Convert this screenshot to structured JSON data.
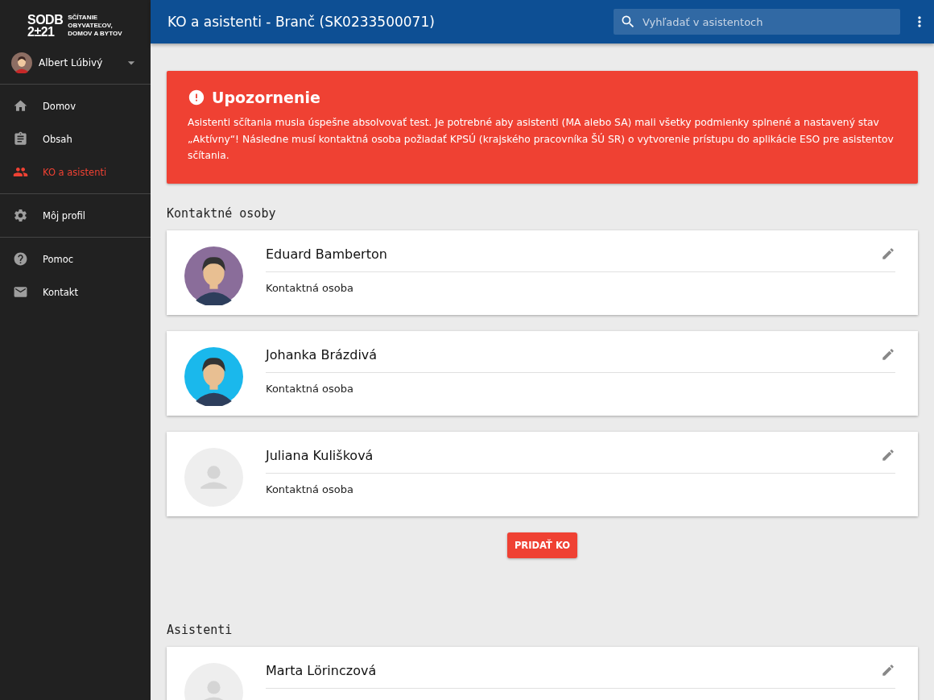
{
  "logo": {
    "mark_top": "SODB",
    "mark_bottom": "2±21",
    "text": "SČÍTANIE OBYVATEĽOV, DOMOV A BYTOV"
  },
  "user": {
    "name": "Albert Lúbivý"
  },
  "nav": [
    [
      {
        "label": "Domov",
        "kind": "home",
        "selected": false
      },
      {
        "label": "Obsah",
        "kind": "clipboard",
        "selected": false
      },
      {
        "label": "KO a asistenti",
        "kind": "people",
        "selected": true
      }
    ],
    [
      {
        "label": "Môj profil",
        "kind": "gear",
        "selected": false
      }
    ],
    [
      {
        "label": "Pomoc",
        "kind": "help",
        "selected": false
      },
      {
        "label": "Kontakt",
        "kind": "mail",
        "selected": false
      }
    ]
  ],
  "header": {
    "title": "KO a asistenti - Branč (SK0233500071)",
    "search_placeholder": "Vyhľadať v asistentoch"
  },
  "alert": {
    "title": "Upozornenie",
    "text": "Asistenti sčítania musia úspešne absolvovať test. Je potrebné aby asistenti (MA alebo SA) mali všetky podmienky splnené a nastavený stav „Aktívny“! Následne musí kontaktná osoba požiadať KPSÚ (krajského pracovníka ŠÚ SR) o vytvorenie prístupu do aplikácie ESO pre asistentov sčítania."
  },
  "sections": [
    {
      "title": "Kontaktné osoby",
      "people": [
        {
          "name": "Eduard Bamberton",
          "role": "Kontaktná osoba",
          "avatar": {
            "kind": "figure",
            "color": "#8a6d9a"
          }
        },
        {
          "name": "Johanka Brázdivá",
          "role": "Kontaktná osoba",
          "avatar": {
            "kind": "figure",
            "color": "#1ab8ec"
          }
        },
        {
          "name": "Juliana Kulišková",
          "role": "Kontaktná osoba",
          "avatar": {
            "kind": "placeholder",
            "color": "#eeeeee"
          }
        }
      ],
      "button": "PRIDAŤ KO"
    },
    {
      "title": "Asistenti",
      "people": [
        {
          "name": "Marta Lörinczová",
          "avatar": {
            "kind": "placeholder",
            "color": "#eeeeee"
          }
        }
      ]
    }
  ]
}
